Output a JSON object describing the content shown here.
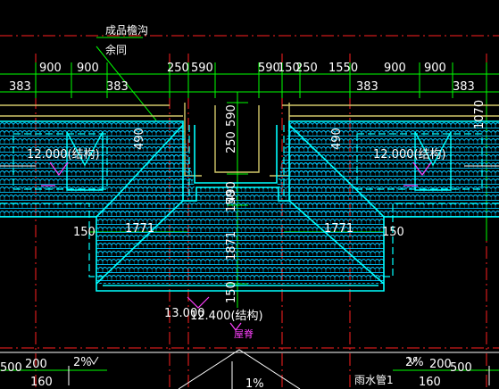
{
  "drawing": {
    "callout_label_line1": "成品檐沟",
    "callout_label_line2": "余同",
    "top_dims": {
      "d900_a": "900",
      "d900_b": "900",
      "d250_left": "250",
      "d590_left": "590",
      "d590_right": "590",
      "d150_right": "150",
      "d250_right": "250",
      "d1550": "1550",
      "d900_c": "900",
      "d900_d": "900",
      "d383_a": "383",
      "d383_b": "383",
      "d383_c": "383",
      "d383_d": "383",
      "d1070": "1070"
    },
    "center_dims": {
      "v590": "590",
      "v250": "250",
      "v490": "490",
      "v1501": "150",
      "v1871": "1871",
      "v1502": "150"
    },
    "side_dims": {
      "left_490": "490",
      "right_490": "490",
      "left_1771": "1771",
      "right_1771": "1771",
      "left_150": "150",
      "right_150": "150"
    },
    "elevations": {
      "left_struct": "12.000(结构)",
      "right_struct": "12.000(结构)",
      "ridge": "13.000",
      "ridge_struct": "12.400(结构)",
      "ridge_small": "屋脊"
    },
    "bottom": {
      "slope_left": "2%",
      "slope_right": "2%",
      "slope_center": "1%",
      "d200_left": "200",
      "d160_left": "160",
      "d500_left": "500",
      "d200_right": "200",
      "d160_right": "160",
      "d500_right": "500",
      "downpipe_label": "雨水管1"
    },
    "colors": {
      "background": "#000000",
      "outline": "#00ffff",
      "tile": "#00c8ff",
      "wall": "#ffffff",
      "gutter": "#d4c96a",
      "dim_line": "#00ff00",
      "axis": "#ff2020",
      "marker": "#ff40ff"
    }
  }
}
